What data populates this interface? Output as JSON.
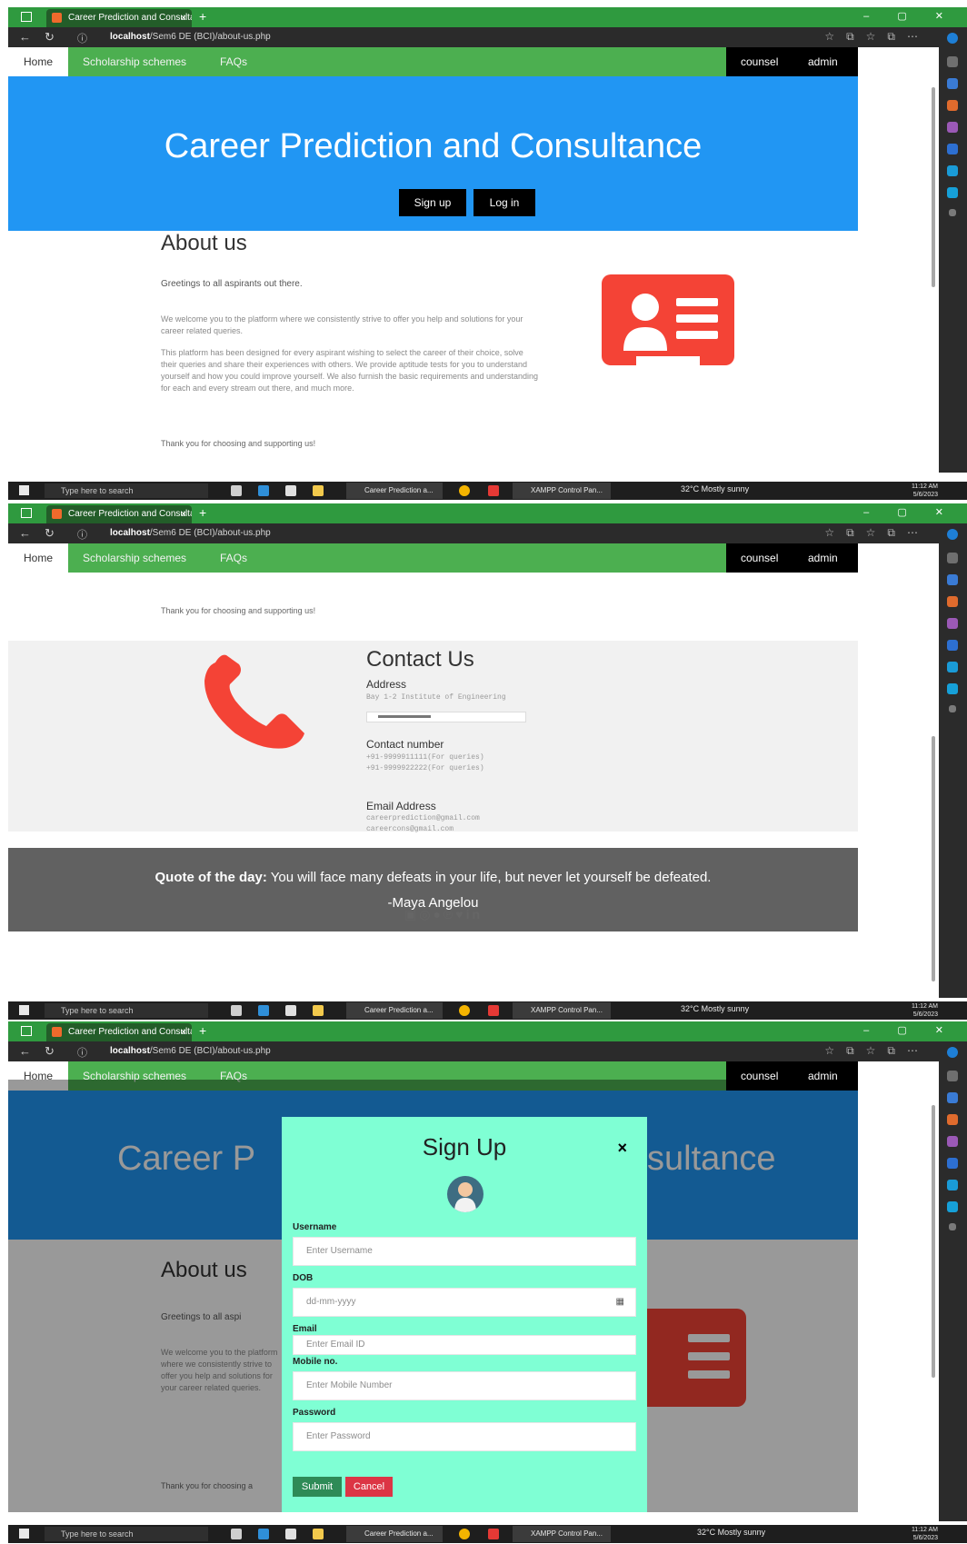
{
  "browser": {
    "tab_title": "Career Prediction and Consultanc",
    "tab_close": "×",
    "new_tab": "+",
    "url_host": "localhost",
    "url_path": "/Sem6 DE (BCI)/about-us.php"
  },
  "nav": {
    "home": "Home",
    "scholarship": "Scholarship schemes",
    "faqs": "FAQs",
    "counsel": "counsel",
    "admin": "admin"
  },
  "hero": {
    "title": "Career Prediction and Consultance",
    "title_partial_left": "Career P",
    "title_partial_right": "sultance",
    "signup": "Sign up",
    "login": "Log in"
  },
  "about": {
    "title": "About us",
    "greeting": "Greetings to all aspirants out there.",
    "greeting_partial": "Greetings to all aspi",
    "p1": "We welcome you to the platform where we consistently strive to offer you help and solutions for your career related queries.",
    "p2": "This platform has been designed for every aspirant wishing to select the career of their choice, solve their queries and share their experiences with others. We provide aptitude tests for you to understand yourself and how you could improve yourself. We also furnish the basic requirements and understanding for each and every stream out there, and much more.",
    "thanks": "Thank you for choosing and supporting us!",
    "thanks_partial": "Thank you for choosing a"
  },
  "contact": {
    "title": "Contact Us",
    "address_label": "Address",
    "address_value": "Bay 1-2 Institute of Engineering",
    "number_label": "Contact number",
    "number_1": "+91-9999911111(For queries)",
    "number_2": "+91-9999922222(For queries)",
    "email_label": "Email Address",
    "email_1": "careerprediction@gmail.com",
    "email_2": "careercons@gmail.com"
  },
  "quote": {
    "prefix": "Quote of the day:",
    "text": " You will face many defeats in your life, but never let yourself be defeated.",
    "author": "-Maya Angelou"
  },
  "social_icons": [
    "facebook-icon",
    "instagram-icon",
    "github-icon",
    "pinterest-icon",
    "twitter-icon",
    "linkedin-icon"
  ],
  "modal": {
    "title": "Sign Up",
    "close": "×",
    "username_label": "Username",
    "username_placeholder": "Enter Username",
    "dob_label": "DOB",
    "dob_placeholder": "dd-mm-yyyy",
    "email_label": "Email",
    "email_placeholder": "Enter Email ID",
    "mobile_label": "Mobile no.",
    "mobile_placeholder": "Enter Mobile Number",
    "password_label": "Password",
    "password_placeholder": "Enter Password",
    "submit": "Submit",
    "cancel": "Cancel"
  },
  "taskbar": {
    "search_placeholder": "Type here to search",
    "app_browser": "Career Prediction a...",
    "app_xampp": "XAMPP Control Pan...",
    "weather": "32°C  Mostly sunny",
    "time": "11:12 AM",
    "date": "5/6/2023"
  },
  "colors": {
    "browser_green": "#2f9a3f",
    "navbar_green": "#4caf50",
    "hero_blue": "#2196f3",
    "icon_red": "#f44336",
    "quote_gray": "#616161",
    "modal_bg": "#7fffd4",
    "submit_green": "#2e8b57",
    "cancel_red": "#dc3545"
  }
}
